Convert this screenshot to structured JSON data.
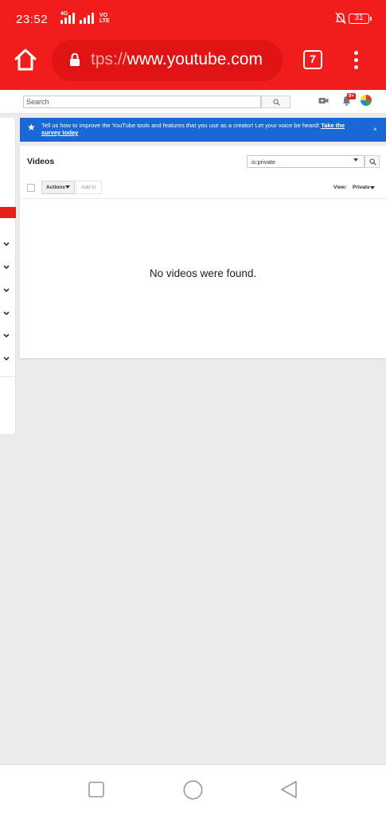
{
  "status_bar": {
    "time": "23:52",
    "network_label": "4G",
    "volte_label_top": "VO",
    "volte_label_bottom": "LTE",
    "battery": "31"
  },
  "browser": {
    "url_prefix": "tps://",
    "url_host": "www.youtube.com",
    "tab_count": "7"
  },
  "masthead": {
    "search_placeholder": "Search",
    "notification_count": "9+"
  },
  "banner": {
    "message": "Tell us how to improve the YouTube tools and features that you use as a creator! Let your voice be heard! ",
    "link_text": "Take the survey today",
    "close": "×"
  },
  "videos": {
    "title": "Videos",
    "filter_value": "is:private",
    "actions_label": "Actions",
    "add_to_label": "Add to",
    "view_label": "View:",
    "view_value": "Private",
    "empty_message": "No videos were found."
  },
  "colors": {
    "chrome_red": "#f11c1c",
    "banner_blue": "#1a68d6",
    "youtube_red": "#e62117"
  }
}
